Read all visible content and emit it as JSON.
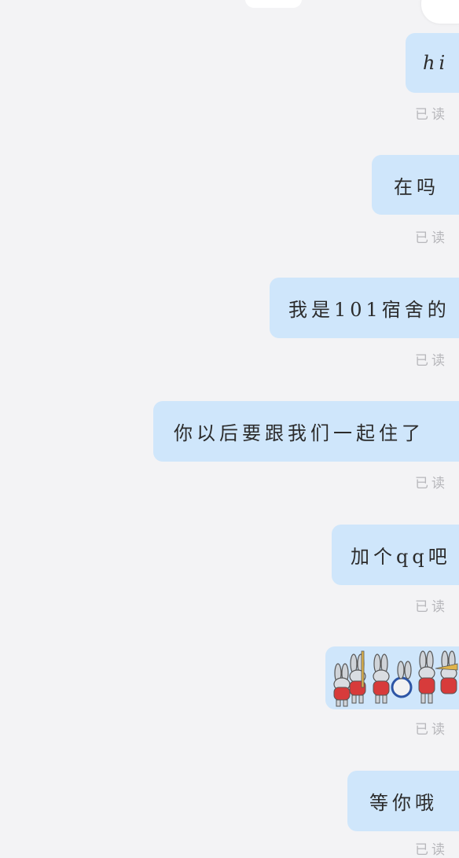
{
  "messages": [
    {
      "text": "hi",
      "status": "已读"
    },
    {
      "text": "在吗",
      "status": "已读"
    },
    {
      "text": "我是101宿舍的",
      "status": "已读"
    },
    {
      "text": "你以后要跟我们一起住了",
      "status": "已读"
    },
    {
      "text": "加个qq吧",
      "status": "已读"
    },
    {
      "sticker": "rabbit-marching-band-sticker",
      "status": "已读"
    },
    {
      "text": "等你哦",
      "status": "已读"
    }
  ],
  "colors": {
    "background": "#f3f3f5",
    "bubble": "#cfe6fb",
    "text": "#2b2b2b",
    "read_status": "#b7b7bb"
  }
}
